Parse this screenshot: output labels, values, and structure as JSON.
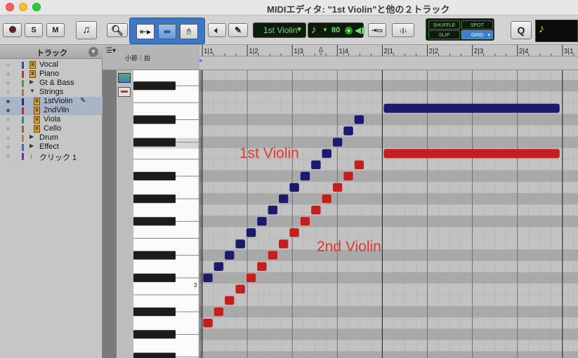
{
  "window": {
    "title": "MIDIエディタ: \"1st Violin\"と他の２トラック"
  },
  "toolbar": {
    "record_icon": "record-icon",
    "solo_label": "S",
    "mute_label": "M",
    "midi_icon": "music-note-icon",
    "zoom_icon": "magnifier-icon",
    "trim_icon": "trim-tool-icon",
    "select_icon": "selector-tool-icon",
    "grab_icon": "grabber-hand-icon",
    "scrub_icon": "speaker-scrub-icon",
    "pencil_icon": "pencil-icon",
    "track_select": "1st Violin",
    "velocity": "80",
    "edit_modes": [
      "SHUFFLE",
      "SPOT",
      "SLIP",
      "GRID"
    ],
    "active_mode": "GRID",
    "quantize_label": "Q",
    "grid_note_icon": "quarter-note-icon"
  },
  "tracklist": {
    "header": "トラック",
    "tracks": [
      {
        "name": "Vocal",
        "color": "#2a44c8",
        "kind": "midi",
        "indent": 0
      },
      {
        "name": "Piano",
        "color": "#cc2a2a",
        "kind": "midi",
        "indent": 0
      },
      {
        "name": "Gt & Bass",
        "color": "#3aa03a",
        "kind": "folder-closed",
        "indent": 0
      },
      {
        "name": "Strings",
        "color": "#cc6a1a",
        "kind": "folder-open",
        "indent": 0
      },
      {
        "name": "1stViolin",
        "color": "#1e2a90",
        "kind": "midi",
        "indent": 1,
        "selected": true
      },
      {
        "name": "2ndViln",
        "color": "#cc2a2a",
        "kind": "midi",
        "indent": 1,
        "selected": true
      },
      {
        "name": "Viola",
        "color": "#2a8a8a",
        "kind": "midi",
        "indent": 1
      },
      {
        "name": "Cello",
        "color": "#a0602a",
        "kind": "midi",
        "indent": 1
      },
      {
        "name": "Drum",
        "color": "#c87a2a",
        "kind": "folder-closed",
        "indent": 0
      },
      {
        "name": "Effect",
        "color": "#3a6ad0",
        "kind": "folder-closed",
        "indent": 0
      },
      {
        "name": "クリック 1",
        "color": "#7a2ac0",
        "kind": "click",
        "indent": 0
      }
    ]
  },
  "ruler": {
    "label": "小節｜拍",
    "marks": [
      "1|1",
      "1|2",
      "1|3",
      "1|4",
      "2|1",
      "2|2",
      "2|3",
      "2|4",
      "3|1"
    ]
  },
  "piano": {
    "c_label": "3"
  },
  "annotations": {
    "first_violin": "1st Violin",
    "second_violin": "2nd Violin"
  },
  "colors": {
    "first_violin_notes": "#1b1b6e",
    "second_violin_notes": "#c41f1f",
    "annotation_text": "#e4352e"
  },
  "notes": {
    "first_violin": {
      "staircase_steps": 15,
      "held_note_start": "2|1",
      "held_note_end": "2|4 (end)"
    },
    "second_violin": {
      "staircase_steps": 15,
      "held_note_start": "2|1",
      "held_note_end": "2|4 (end)"
    }
  }
}
